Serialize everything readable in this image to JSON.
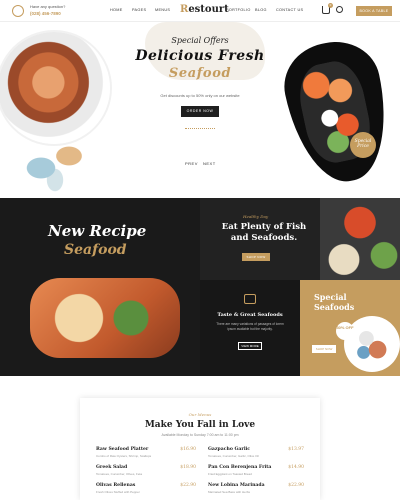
{
  "header": {
    "contact_question": "Have any question?",
    "contact_number": "(028) 456-7890",
    "nav_left": [
      "HOME",
      "PAGES",
      "MENUS"
    ],
    "logo_initial": "R",
    "logo_rest": "estourt",
    "nav_right": [
      "PORTFOLIO",
      "BLOG",
      "CONTACT US"
    ],
    "cart_count": "0",
    "book_label": "BOOK A TABLE"
  },
  "hero": {
    "special_offers": "Special Offers",
    "title": "Delicious Fresh",
    "subtitle": "Seafood",
    "text": "Get discounts up to 50% only on our website",
    "order_label": "ORDER NOW",
    "badge": "Special Price",
    "prev": "PREV",
    "next": "NEXT"
  },
  "banners": {
    "recipe_title": "New Recipe",
    "recipe_sub": "Seafood",
    "healthy_script": "Healthy Day",
    "healthy_title": "Eat Plenty of Fish and Seafoods.",
    "healthy_btn": "SHOP NOW",
    "taste_title": "Taste & Great Seafoods",
    "taste_text": "There are many variations of passages of lorem ipsum available but the majority.",
    "taste_btn": "VIEW MORE",
    "special_title": "Special Seafoods",
    "special_off": "30% OFF",
    "special_btn": "SHOP NOW"
  },
  "menu": {
    "script": "Our Menus",
    "title": "Make You Fall in Love",
    "availability": "Available Monday to Sunday 7:00 am to 11:00 pm",
    "left_items": [
      {
        "name": "Raw Seafood Platter",
        "price": "$16.90",
        "desc": "Combo of Raw Oysters, Shrimp, Scallops"
      },
      {
        "name": "Greek Salad",
        "price": "$18.90",
        "desc": "Tomatoes, Cucumber, Olives, Feta"
      },
      {
        "name": "Olivas Rellenas",
        "price": "$22.90",
        "desc": "Fresh Olives Stuffed with Pepper"
      }
    ],
    "right_items": [
      {
        "name": "Gazpacho Garlic",
        "price": "$13.97",
        "desc": "Tomatoes, Cucumber, Garlic, Olive Oil"
      },
      {
        "name": "Pan Con Berenjena Frita",
        "price": "$14.90",
        "desc": "Fried Eggplant on Toasted Bread"
      },
      {
        "name": "New Lobina Marinada",
        "price": "$22.90",
        "desc": "Marinated Sea Bass with Herbs"
      }
    ]
  }
}
